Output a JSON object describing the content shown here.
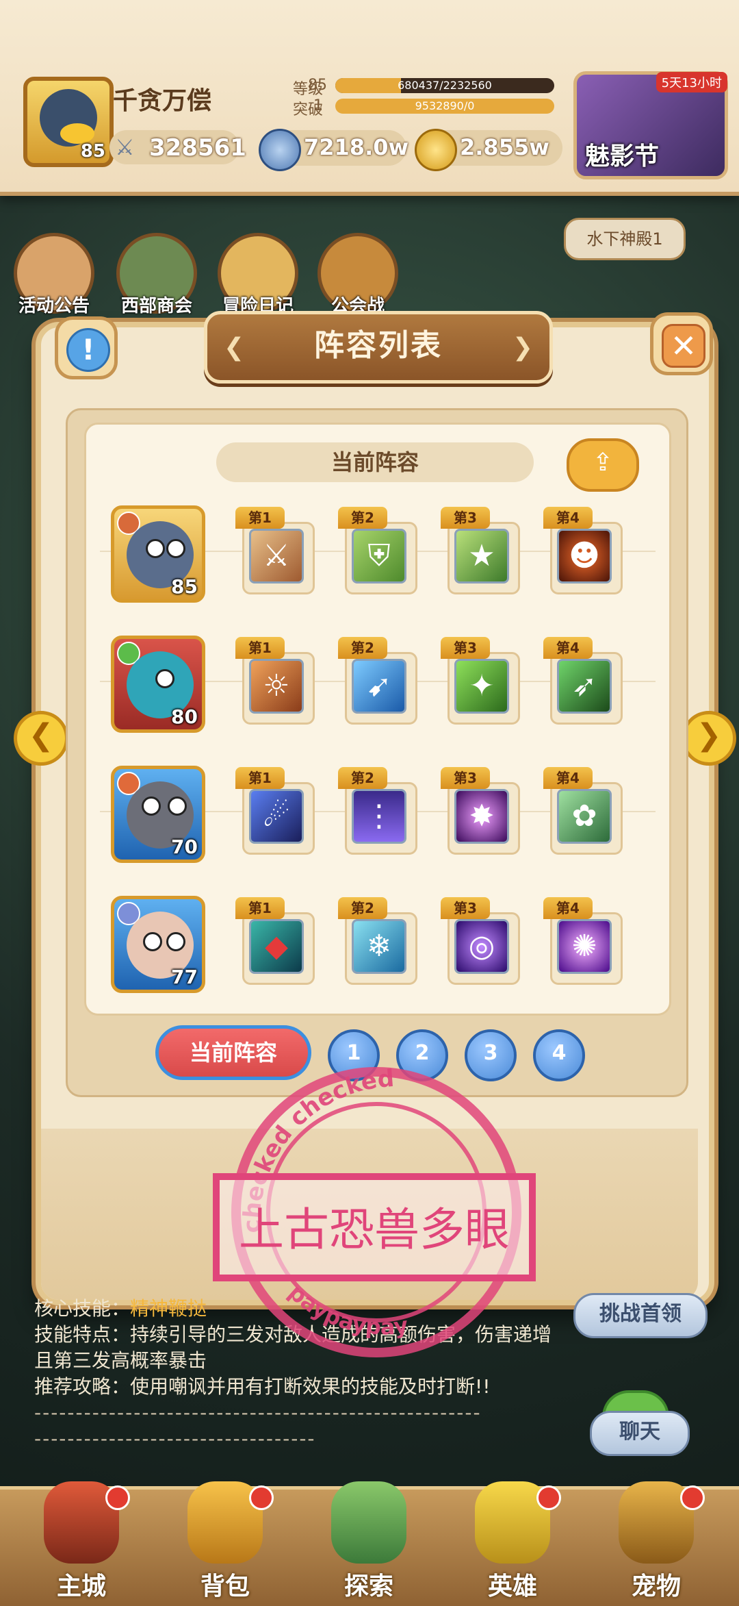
{
  "header": {
    "player_name": "千贪万偿",
    "player_level": "85",
    "power": "328561",
    "level_label": "等级",
    "level_value": "85",
    "level_progress": "680437/2232560",
    "break_label": "突破",
    "break_value": "1",
    "break_progress": "9532890/0",
    "currency_1": "7218.0w",
    "currency_2": "2.855w",
    "event_label": "魅影节",
    "event_tag": "5天13小时"
  },
  "shortcuts": [
    "活动公告",
    "西部商会",
    "冒险日记",
    "公会战"
  ],
  "dungeon_tag": "水下神殿1",
  "modal": {
    "title": "阵容列表",
    "current_banner": "当前阵容",
    "rows": [
      {
        "level": "85",
        "skills": [
          "第1",
          "第2",
          "第3",
          "第4"
        ]
      },
      {
        "level": "80",
        "skills": [
          "第1",
          "第2",
          "第3",
          "第4"
        ]
      },
      {
        "level": "70",
        "skills": [
          "第1",
          "第2",
          "第3",
          "第4"
        ]
      },
      {
        "level": "77",
        "skills": [
          "第1",
          "第2",
          "第3",
          "第4"
        ]
      }
    ],
    "tabs": {
      "current": "当前阵容",
      "nums": [
        "1",
        "2",
        "3",
        "4"
      ]
    }
  },
  "stamp": {
    "text": "上古恐兽多眼",
    "ring_top": "checked checked",
    "ring_bottom": "paypaypay"
  },
  "info": {
    "core_label": "核心技能：",
    "core_value": "精神鞭挞",
    "feature_label": "技能特点：",
    "feature_value": "持续引导的三发对敌人造成的高额伤害，伤害递增且第三发高概率暴击",
    "strategy_label": "推荐攻略：",
    "strategy_value": "使用嘲讽并用有打断效果的技能及时打断!!",
    "dash_1": "------------------------------------------------------",
    "dash_2": "----------------------------------"
  },
  "side_buttons": {
    "challenge": "挑战首领",
    "chat": "聊天"
  },
  "bottom_nav": [
    "主城",
    "背包",
    "探索",
    "英雄",
    "宠物"
  ],
  "colors": {
    "accent": "#f2b43d",
    "title_plate": "#8b5528",
    "stamp": "#e0457a"
  }
}
